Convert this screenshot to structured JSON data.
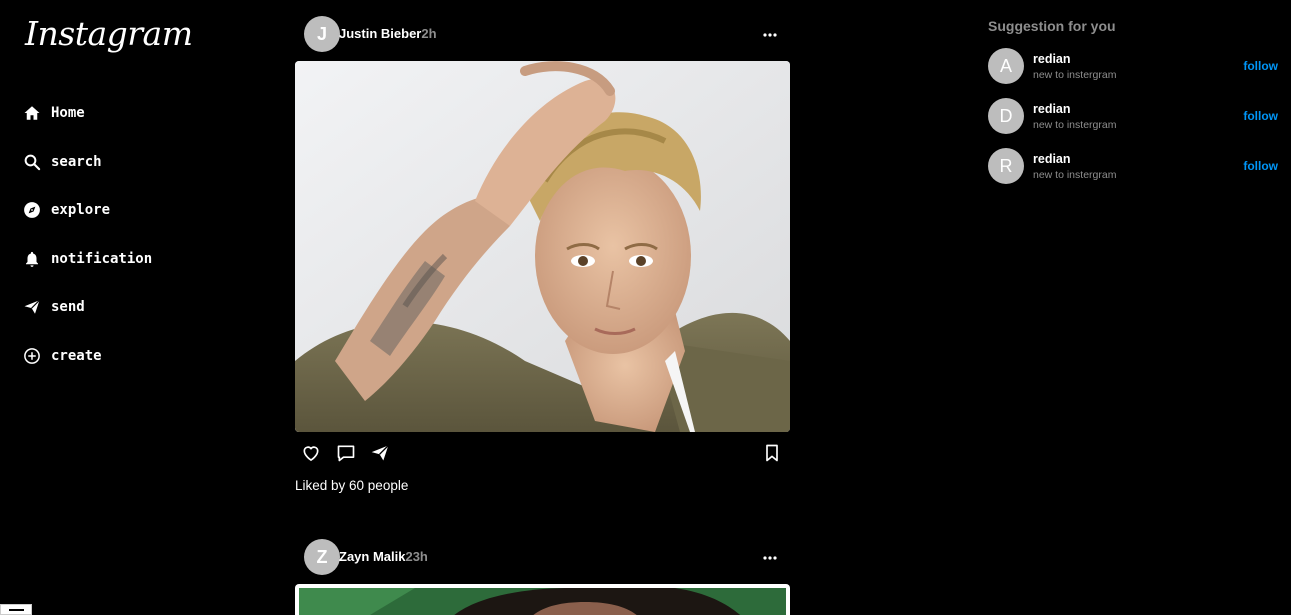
{
  "app": {
    "logo": "Instagram"
  },
  "nav": [
    {
      "label": "Home",
      "icon": "home-icon"
    },
    {
      "label": "search",
      "icon": "search-icon"
    },
    {
      "label": "explore",
      "icon": "compass-icon"
    },
    {
      "label": "notification",
      "icon": "bell-icon"
    },
    {
      "label": "send",
      "icon": "send-icon"
    },
    {
      "label": "create",
      "icon": "plus-circle-icon"
    }
  ],
  "posts": [
    {
      "avatar_letter": "J",
      "username": "Justin Bieber",
      "time": "2h",
      "likes_text": "Liked by 60 people",
      "image": "portrait photo of young man with blond hair in green jacket"
    },
    {
      "avatar_letter": "Z",
      "username": "Zayn Malik",
      "time": "23h",
      "image": "portrait photo"
    }
  ],
  "suggestions": {
    "title": "Suggestion for you",
    "items": [
      {
        "avatar_letter": "A",
        "name": "redian",
        "subtitle": "new to instergram",
        "action": "follow"
      },
      {
        "avatar_letter": "D",
        "name": "redian",
        "subtitle": "new to instergram",
        "action": "follow"
      },
      {
        "avatar_letter": "R",
        "name": "redian",
        "subtitle": "new to instergram",
        "action": "follow"
      }
    ]
  },
  "colors": {
    "background": "#000000",
    "link": "#0095f6",
    "muted": "#8e8e8e",
    "avatar": "#bdbdbd"
  }
}
